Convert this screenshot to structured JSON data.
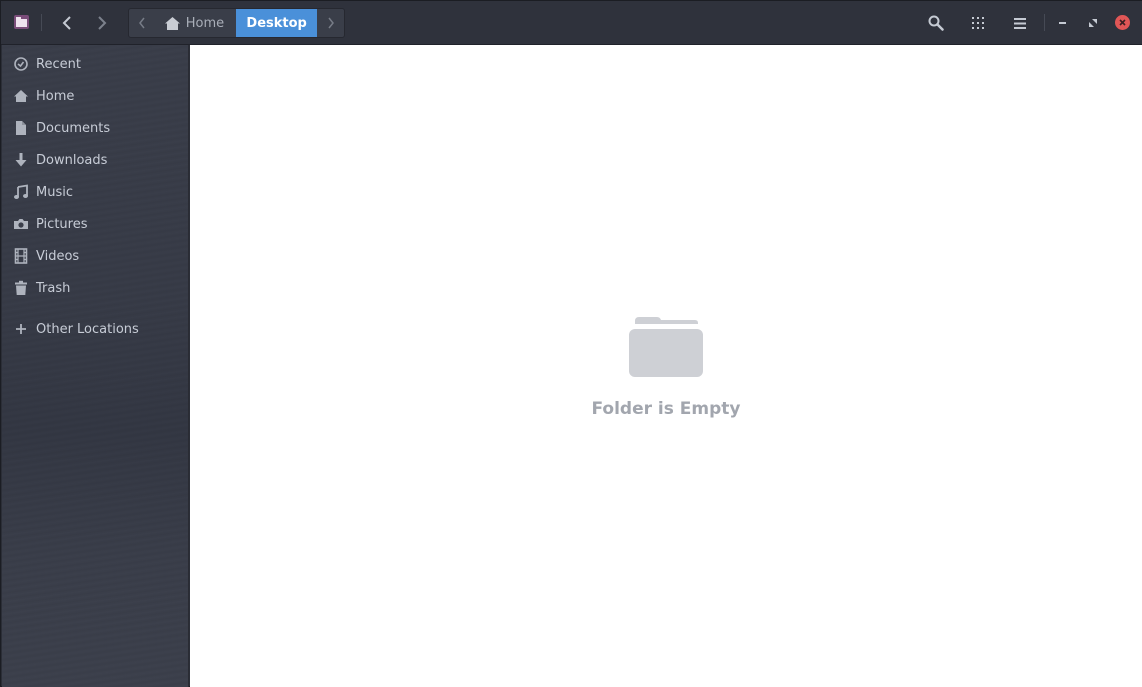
{
  "header": {
    "app_icon": "file-manager-icon",
    "back_label": "Back",
    "forward_label": "Forward",
    "path": [
      {
        "label": "Home",
        "icon": "home-icon",
        "active": false
      },
      {
        "label": "Desktop",
        "icon": null,
        "active": true
      }
    ],
    "actions": [
      "search-icon",
      "view-grid-icon",
      "menu-icon"
    ],
    "window_controls": [
      "minimize-icon",
      "maximize-icon",
      "close-icon"
    ]
  },
  "sidebar": {
    "items": [
      {
        "label": "Recent",
        "icon": "clock-icon"
      },
      {
        "label": "Home",
        "icon": "home-icon"
      },
      {
        "label": "Documents",
        "icon": "document-icon"
      },
      {
        "label": "Downloads",
        "icon": "download-icon"
      },
      {
        "label": "Music",
        "icon": "music-icon"
      },
      {
        "label": "Pictures",
        "icon": "camera-icon"
      },
      {
        "label": "Videos",
        "icon": "film-icon"
      },
      {
        "label": "Trash",
        "icon": "trash-icon"
      },
      {
        "label": "Other Locations",
        "icon": "plus-icon"
      }
    ]
  },
  "main": {
    "empty_icon": "folder-icon",
    "empty_message": "Folder is Empty"
  },
  "colors": {
    "accent": "#4a90d9",
    "close": "#e05656",
    "header_bg": "#2f323c",
    "sidebar_bg": "#3a3e4a"
  }
}
